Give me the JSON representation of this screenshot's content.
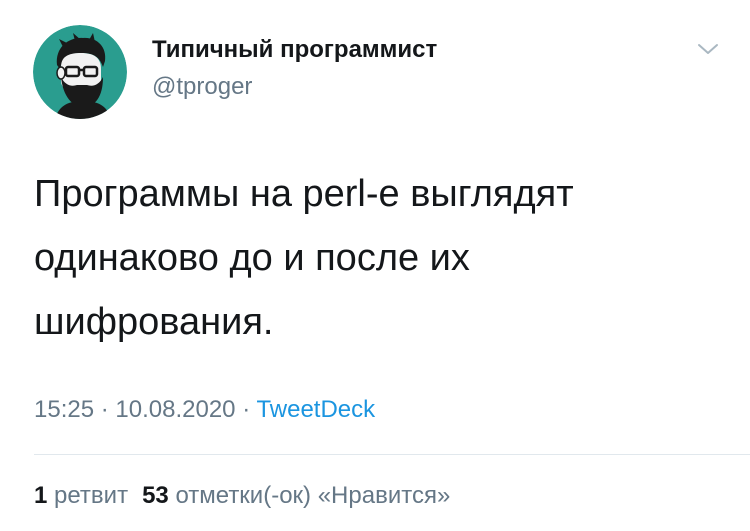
{
  "author": {
    "name": "Типичный программист",
    "handle": "@tproger",
    "avatar_icon": "bearded-man-avatar",
    "avatar_bg": "#2a9d8f"
  },
  "tweet": {
    "text": "Программы на perl-е выглядят\nодинаково до и после их\nшифрования."
  },
  "meta": {
    "time": "15:25",
    "separator": "·",
    "date": "10.08.2020",
    "source": "TweetDeck"
  },
  "stats": {
    "retweets_count": "1",
    "retweets_label": "ретвит",
    "likes_count": "53",
    "likes_label": "отметки(-ок) «Нравится»"
  },
  "colors": {
    "text": "#14171a",
    "secondary": "#657786",
    "link": "#1b95e0",
    "divider": "#e1e8ed"
  },
  "icons": {
    "menu": "chevron-down-icon"
  }
}
